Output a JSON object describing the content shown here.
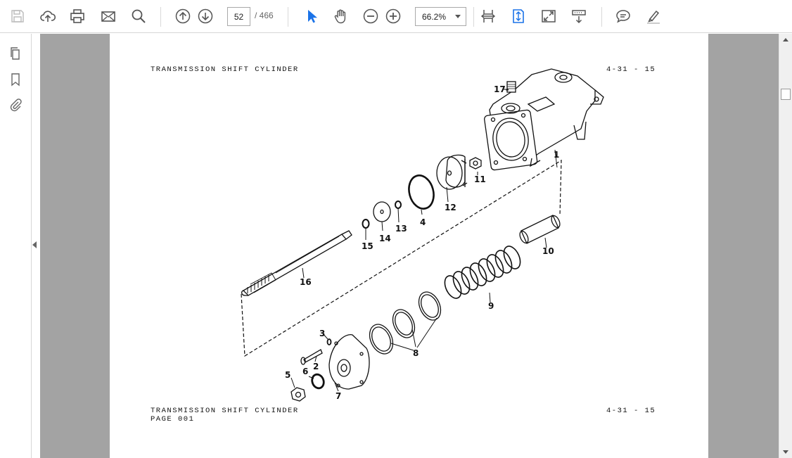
{
  "toolbar": {
    "page_current": "52",
    "page_total": "/ 466",
    "zoom": "66.2%",
    "buttons": [
      "save-icon",
      "cloud-upload-icon",
      "print-icon",
      "email-icon",
      "search-icon",
      "page-up-icon",
      "page-down-icon",
      "select-cursor-icon",
      "hand-icon",
      "zoom-out-icon",
      "zoom-in-icon",
      "fit-width-icon",
      "fit-page-icon",
      "fullscreen-icon",
      "read-mode-icon",
      "comment-icon",
      "highlight-pen-icon"
    ]
  },
  "sidebar": {
    "items": [
      "pages-thumbnail-icon",
      "bookmark-icon",
      "attachment-icon"
    ]
  },
  "document": {
    "header_title": "TRANSMISSION SHIFT CYLINDER",
    "header_code": "4-31 - 15",
    "footer_title": "TRANSMISSION SHIFT CYLINDER",
    "footer_page": "PAGE 001",
    "footer_code": "4-31 - 15",
    "callouts": [
      "1",
      "2",
      "3",
      "4",
      "5",
      "6",
      "7",
      "8",
      "9",
      "10",
      "11",
      "12",
      "13",
      "14",
      "15",
      "16",
      "17-"
    ]
  },
  "colors": {
    "accent_blue": "#1b73e8",
    "doc_background": "#a3a3a3",
    "icon_gray": "#555555"
  }
}
